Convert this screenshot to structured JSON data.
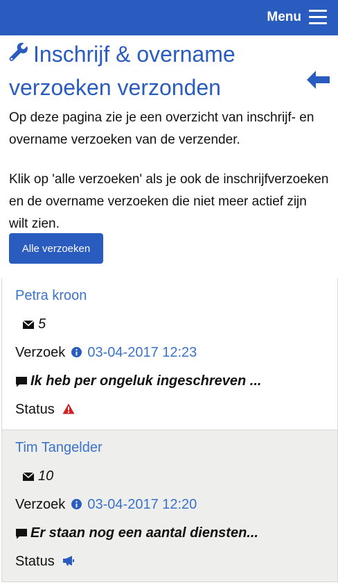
{
  "header": {
    "menu_label": "Menu"
  },
  "page": {
    "title": "Inschrijf & overname verzoeken verzonden",
    "intro_1": "Op deze pagina zie je een overzicht van inschrijf- en overname verzoeken van de verzender.",
    "intro_2": "Klik op 'alle verzoeken' als je ook de inschrijfverzoeken en de overname verzoeken die niet meer actief zijn wilt zien.",
    "all_button": "Alle verzoeken"
  },
  "requests": [
    {
      "name": "Petra kroon",
      "message_count": "5",
      "verzoek_label": "Verzoek",
      "date": "03-04-2017 12:23",
      "message": "Ik heb per ongeluk ingeschreven ...",
      "status_label": "Status",
      "status_icon": "warning-icon",
      "status_color": "#cc2222"
    },
    {
      "name": "Tim Tangelder",
      "message_count": "10",
      "verzoek_label": "Verzoek",
      "date": "03-04-2017 12:20",
      "message": "Er staan nog een aantal diensten...",
      "status_label": "Status",
      "status_icon": "megaphone-icon",
      "status_color": "#2a5cbf"
    }
  ],
  "colors": {
    "primary": "#2a5cbf",
    "link": "#3a72cc"
  }
}
